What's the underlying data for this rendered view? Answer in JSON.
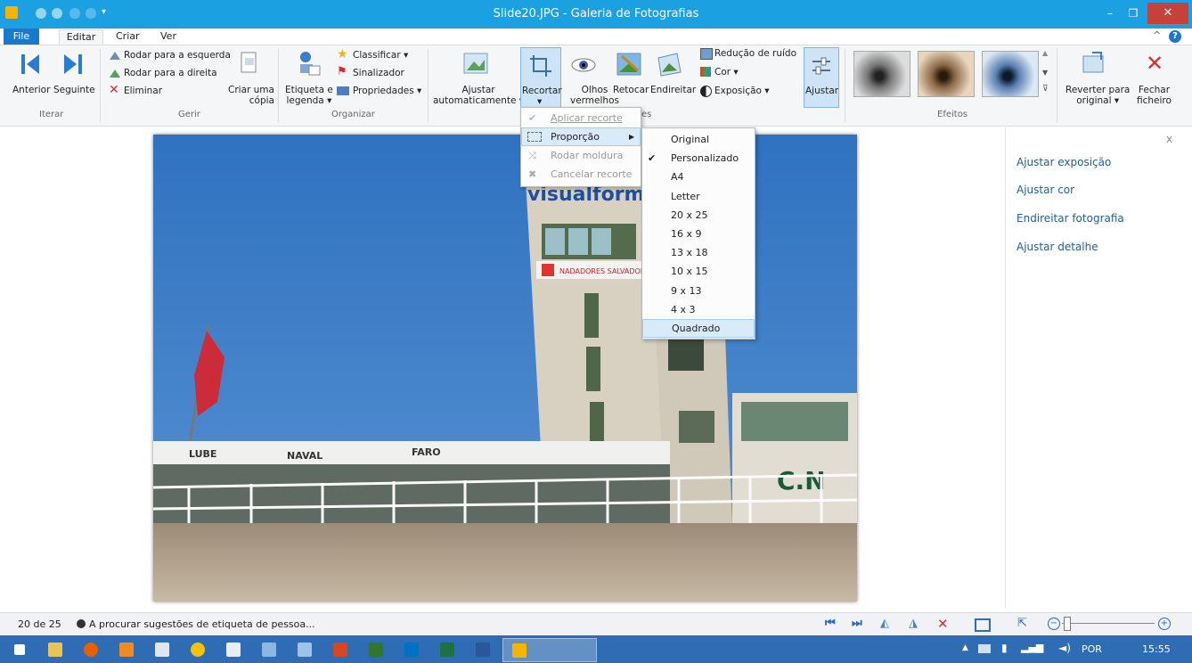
{
  "window": {
    "title": "Slide20.JPG - Galeria de Fotografias"
  },
  "tabs": {
    "file": "File",
    "editar": "Editar",
    "criar": "Criar",
    "ver": "Ver"
  },
  "ribbon": {
    "iterar": {
      "label": "Iterar",
      "anterior": "Anterior",
      "seguinte": "Seguinte"
    },
    "gerir": {
      "label": "Gerir",
      "rodar_esquerda": "Rodar para a esquerda",
      "rodar_direita": "Rodar para a direita",
      "eliminar": "Eliminar",
      "criar_copia_1": "Criar uma",
      "criar_copia_2": "cópia"
    },
    "organizar": {
      "label": "Organizar",
      "etiqueta_1": "Etiqueta e",
      "etiqueta_2": "legenda ▾",
      "classificar": "Classificar ▾",
      "sinalizador": "Sinalizador",
      "propriedades": "Propriedades ▾"
    },
    "ajustes": {
      "label_suffix": "es",
      "ajustar_auto_1": "Ajustar",
      "ajustar_auto_2": "automaticamente ▾",
      "recortar": "Recortar",
      "recortar_arrow": "▾",
      "olhos_1": "Olhos",
      "olhos_2": "vermelhos",
      "retocar": "Retocar",
      "endireitar": "Endireitar",
      "reducao_ruido": "Redução de ruído",
      "cor": "Cor ▾",
      "exposicao": "Exposição ▾",
      "ajustar": "Ajustar"
    },
    "efeitos": {
      "label": "Efeitos"
    },
    "reverter_1": "Reverter para",
    "reverter_2": "original ▾",
    "fechar_1": "Fechar",
    "fechar_2": "ficheiro"
  },
  "crop_menu": {
    "items": [
      "Aplicar recorte",
      "Proporção",
      "Rodar moldura",
      "Cancelar recorte"
    ]
  },
  "proportion_menu": {
    "items": [
      "Original",
      "Personalizado",
      "A4",
      "Letter",
      "20 x 25",
      "16 x 9",
      "13 x 18",
      "10 x 15",
      "9 x 13",
      "4 x 3",
      "Quadrado"
    ],
    "checked": "Personalizado",
    "hovered": "Quadrado"
  },
  "side_panel": {
    "close": "x",
    "links": [
      "Ajustar exposição",
      "Ajustar cor",
      "Endireitar fotografia",
      "Ajustar detalhe"
    ]
  },
  "status": {
    "position": "20 de 25",
    "message": "A procurar sugestões de etiqueta de pessoa..."
  },
  "taskbar": {
    "language": "POR",
    "time": "15:55"
  },
  "photo_signs": {
    "top_sign": "visualforma",
    "banner": "NADADORES SALVADORES",
    "awning_1": "LUBE",
    "awning_2": "NAVAL",
    "awning_3": "FARO",
    "wall": "C.N"
  },
  "colors": {
    "accent": "#1ba1e2",
    "file_tab": "#1979ca",
    "close": "#c7413b",
    "taskbar": "#2f6cb3",
    "link": "#24608f",
    "sky": "#3f7fc6"
  }
}
